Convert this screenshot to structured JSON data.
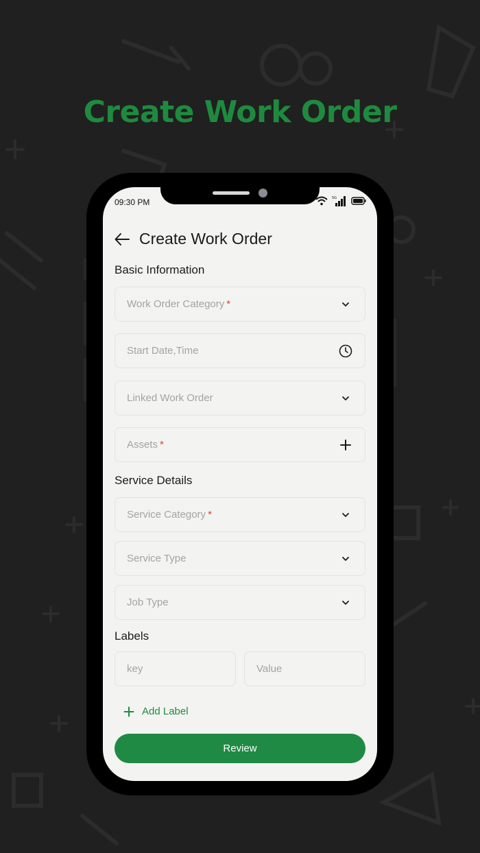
{
  "hero": {
    "title": "Create Work Order"
  },
  "status_bar": {
    "time": "09:30 PM",
    "network": "5G"
  },
  "header": {
    "title": "Create Work Order"
  },
  "sections": {
    "basic": "Basic Information",
    "service": "Service Details",
    "labels": "Labels"
  },
  "fields": {
    "work_order_category": {
      "placeholder": "Work Order Category",
      "required": "*",
      "icon": "chevron-down-icon"
    },
    "start_date": {
      "placeholder": "Start Date,Time",
      "icon": "clock-icon"
    },
    "linked_work_order": {
      "placeholder": "Linked Work Order",
      "icon": "chevron-down-icon"
    },
    "assets": {
      "placeholder": "Assets",
      "required": "*",
      "icon": "plus-icon"
    },
    "service_category": {
      "placeholder": "Service Category",
      "required": "*",
      "icon": "chevron-down-icon"
    },
    "service_type": {
      "placeholder": "Service Type",
      "icon": "chevron-down-icon"
    },
    "job_type": {
      "placeholder": "Job Type",
      "icon": "chevron-down-icon"
    },
    "label_key": {
      "placeholder": "key"
    },
    "label_value": {
      "placeholder": "Value"
    }
  },
  "actions": {
    "add_label": "Add Label",
    "review": "Review"
  },
  "colors": {
    "background": "#202020",
    "brand_green": "#1f8a3f",
    "button_green": "#1f8a44",
    "required_red": "#d9453a",
    "screen_bg": "#f3f4f1"
  }
}
